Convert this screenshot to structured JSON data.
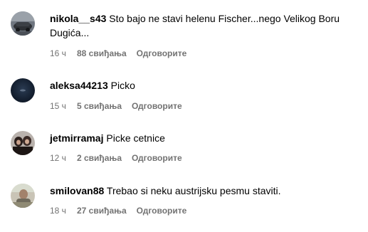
{
  "comments": [
    {
      "username": "nikola__s43",
      "text": "Sto bajo ne stavi helenu Fischer...nego Velikog Boru Dugića...",
      "time": "16 ч",
      "likes": "88 свиђања",
      "reply": "Одговорите",
      "avatar": "car-photo-avatar"
    },
    {
      "username": "aleksa44213",
      "text": "Picko",
      "time": "15 ч",
      "likes": "5 свиђања",
      "reply": "Одговорите",
      "avatar": "dark-blue-avatar"
    },
    {
      "username": "jetmirramaj",
      "text": "Picke cetnice",
      "time": "12 ч",
      "likes": "2 свиђања",
      "reply": "Одговорите",
      "avatar": "person-photo-avatar"
    },
    {
      "username": "smilovan88",
      "text": "Trebao si neku austrijsku pesmu staviti.",
      "time": "18 ч",
      "likes": "27 свиђања",
      "reply": "Одговорите",
      "avatar": "outdoor-photo-avatar"
    }
  ],
  "colors": {
    "text": "#000000",
    "meta": "#737373",
    "background": "#ffffff"
  }
}
